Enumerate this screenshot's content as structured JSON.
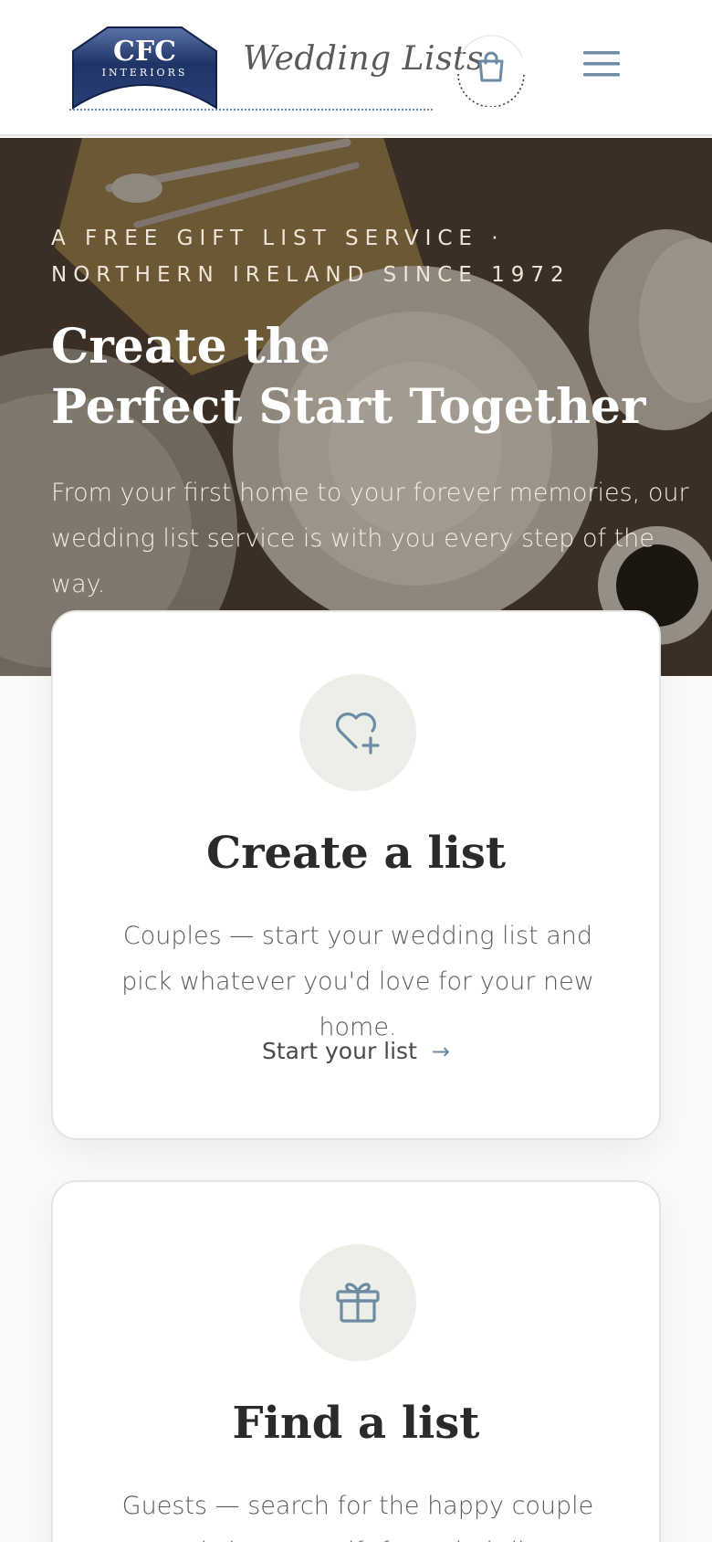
{
  "header": {
    "logo": {
      "main": "CFC",
      "sub": "INTERIORS"
    },
    "brand_title": "Wedding Lists",
    "cart_icon": "shopping-bag-icon",
    "menu_icon": "hamburger-menu-icon"
  },
  "hero": {
    "eyebrow": "A free gift list service · Northern Ireland since 1972",
    "title_line1": "Create the",
    "title_line2": "Perfect Start Together",
    "subtitle": "From your first home to your forever memories, our wedding list service is with you every step of the way."
  },
  "cards": [
    {
      "icon": "heart-plus-icon",
      "title": "Create a list",
      "text": "Couples — start your wedding list and pick whatever you'd love for your new home.",
      "link": "Start your list"
    },
    {
      "icon": "gift-icon",
      "title": "Find a list",
      "text": "Guests — search for the happy couple and choose a gift from their list."
    }
  ],
  "colors": {
    "accent": "#6d8ba3",
    "icon_circle": "#eceee8",
    "logo_navy": "#1f3466"
  }
}
